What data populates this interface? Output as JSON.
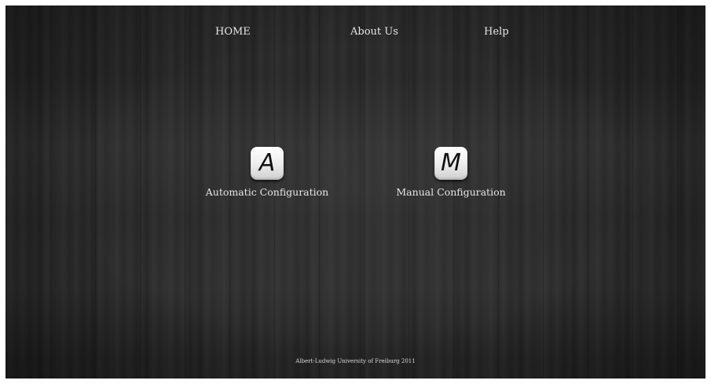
{
  "nav": {
    "home": "HOME",
    "about": "About Us",
    "help": "Help"
  },
  "options": {
    "automatic": {
      "letter": "A",
      "label": "Automatic Configuration"
    },
    "manual": {
      "letter": "M",
      "label": "Manual Configuration"
    }
  },
  "footer": {
    "text": "Albert-Ludwig University of Freiburg 2011"
  },
  "colors": {
    "background": "#2a2a2a",
    "text": "#e6e6e6",
    "tile": "#f2f2f2"
  }
}
